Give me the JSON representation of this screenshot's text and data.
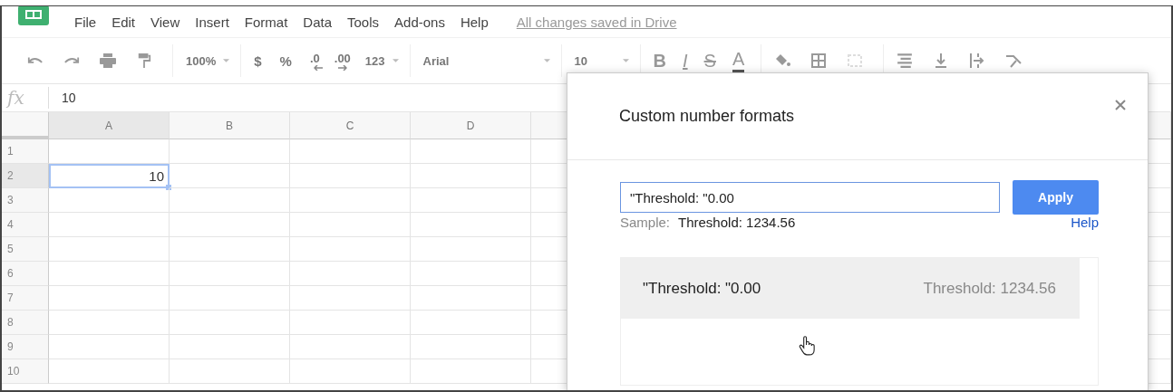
{
  "menu": {
    "items": [
      "File",
      "Edit",
      "View",
      "Insert",
      "Format",
      "Data",
      "Tools",
      "Add-ons",
      "Help"
    ],
    "save_status": "All changes saved in Drive"
  },
  "toolbar": {
    "zoom": "100%",
    "currency": "$",
    "percent": "%",
    "decrease_decimals": ".0",
    "increase_decimals": ".00",
    "more_formats": "123",
    "font": "Arial",
    "font_size": "10",
    "bold": "B",
    "italic": "I",
    "strikethrough": "S",
    "text_color": "A"
  },
  "formula_bar": {
    "label": "fx",
    "value": "10"
  },
  "grid": {
    "columns": [
      {
        "label": "A",
        "selected": true
      },
      {
        "label": "B",
        "selected": false
      },
      {
        "label": "C",
        "selected": false
      },
      {
        "label": "D",
        "selected": false
      }
    ],
    "rows": [
      {
        "label": "1",
        "selected": false
      },
      {
        "label": "2",
        "selected": true,
        "cells": [
          {
            "text": "10",
            "selected": true
          }
        ]
      },
      {
        "label": "3",
        "selected": false
      },
      {
        "label": "4",
        "selected": false
      },
      {
        "label": "5",
        "selected": false
      },
      {
        "label": "6",
        "selected": false
      },
      {
        "label": "7",
        "selected": false
      },
      {
        "label": "8",
        "selected": false
      },
      {
        "label": "9",
        "selected": false
      },
      {
        "label": "10",
        "selected": false
      }
    ]
  },
  "dialog": {
    "title": "Custom number formats",
    "format_input": "\"Threshold: \"0.00",
    "apply_button": "Apply",
    "sample_label": "Sample:",
    "sample_value": "Threshold: 1234.56",
    "help_link": "Help",
    "formats": [
      {
        "format": "\"Threshold: \"0.00",
        "sample": "Threshold: 1234.56",
        "selected": true
      }
    ]
  }
}
